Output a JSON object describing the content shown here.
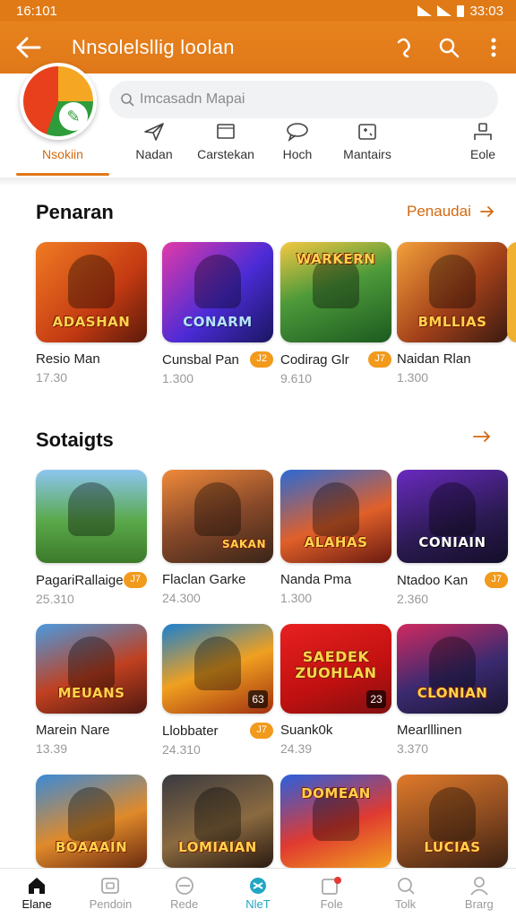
{
  "status": {
    "time": "16:101",
    "clock": "33:03"
  },
  "appbar": {
    "title": "Nnsolelsllig loolan"
  },
  "search": {
    "placeholder": "Imcasadn Mapai"
  },
  "categories": [
    {
      "label": "Nsokiin",
      "icon": "app-logo-icon"
    },
    {
      "label": "Nadan",
      "icon": "send-icon"
    },
    {
      "label": "Carstekan",
      "icon": "folder-icon"
    },
    {
      "label": "Hoch",
      "icon": "chat-icon"
    },
    {
      "label": "Mantairs",
      "icon": "gamepad-icon"
    },
    {
      "label": "Eole",
      "icon": "people-icon"
    }
  ],
  "section1": {
    "title": "Penaran",
    "more": "Penaudai",
    "items": [
      {
        "name": "Resio Man",
        "count": "17.30",
        "art": "ADASHAN"
      },
      {
        "name": "Cunsbal Pan",
        "count": "1.300",
        "badge": "J2",
        "art": "CONARM"
      },
      {
        "name": "Codirag Glr",
        "count": "9.610",
        "badge": "J7",
        "art": "WARKERN"
      },
      {
        "name": "Naidan Rlan",
        "count": "1.300",
        "art": "BMLLIAS"
      }
    ]
  },
  "section2": {
    "title": "Sotaigts",
    "rows": [
      [
        {
          "name": "PagariRallaige",
          "count": "25.310",
          "badge": "J7",
          "art": ""
        },
        {
          "name": "Flaclan Garke",
          "count": "24.300",
          "art": "SAKAN"
        },
        {
          "name": "Nanda Pma",
          "count": "1.300",
          "art": "ALAHAS"
        },
        {
          "name": "Ntadoo Kan",
          "count": "2.360",
          "badge": "J7",
          "art": "CONIAIN"
        }
      ],
      [
        {
          "name": "Marein Nare",
          "count": "13.39",
          "art": "MEUANS"
        },
        {
          "name": "Llobbater",
          "count": "24.310",
          "badge": "J7",
          "corner": "63",
          "art": ""
        },
        {
          "name": "Suank0k",
          "count": "24.39",
          "corner": "23",
          "art": "SAEDEK ZUOHLAN"
        },
        {
          "name": "Mearlllinen",
          "count": "3.370",
          "art": "CLONIAN"
        }
      ],
      [
        {
          "name": "",
          "count": "",
          "art": "BOAAAIN"
        },
        {
          "name": "",
          "count": "",
          "art": "LOMIAIAN"
        },
        {
          "name": "",
          "count": "",
          "art": "DOMEAN"
        },
        {
          "name": "",
          "count": "",
          "art": "LUCIAS"
        }
      ]
    ]
  },
  "bottom_nav": [
    {
      "label": "Elane",
      "icon": "home-icon"
    },
    {
      "label": "Pendoin",
      "icon": "square-icon"
    },
    {
      "label": "Rede",
      "icon": "minus-circle-icon"
    },
    {
      "label": "NleT",
      "icon": "game-icon"
    },
    {
      "label": "Fole",
      "icon": "folder-badge-icon"
    },
    {
      "label": "Tolk",
      "icon": "search-icon"
    },
    {
      "label": "Brarg",
      "icon": "person-icon"
    }
  ],
  "colors": {
    "accent": "#e0781a",
    "teal": "#21a6c4",
    "badge": "#f19a1c"
  }
}
